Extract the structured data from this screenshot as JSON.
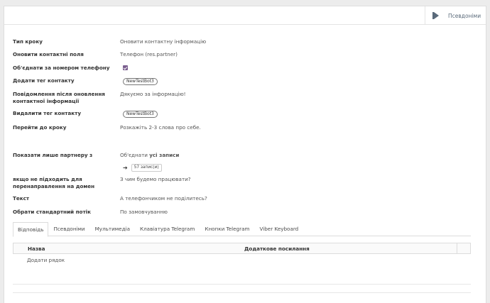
{
  "header": {
    "smart_button_label": "Псевдоніми",
    "smart_button_icon": "flag-icon"
  },
  "fields": {
    "step_type": {
      "label": "Тип кроку",
      "value": "Оновити контактну інформацію"
    },
    "update_fields": {
      "label": "Оновити контактні поля",
      "value": "Телефон (res.partner)"
    },
    "merge_by_phone": {
      "label": "Об'єднати за номером телефону",
      "checked": true
    },
    "add_tag": {
      "label": "Додати тег контакту",
      "tag": "NewTestBot3"
    },
    "message_after_update": {
      "label": "Повідомлення після оновлення контактної інформації",
      "value": "Дякуємо за інформацію!"
    },
    "remove_tag": {
      "label": "Видалити тег контакту",
      "tag": "NewTestBot3"
    },
    "go_to_step": {
      "label": "Перейти до кроку",
      "value": "Розкажіть 2-3 слова про себе."
    },
    "show_only_partner": {
      "label": "Показати лише партнеру з",
      "value_prefix": "Об'єднати ",
      "value_bold": "усі записи",
      "records_button": "57 запис(и)"
    },
    "if_not_fit": {
      "label": "якщо не підходить для перенаправлення на домен",
      "value": "З чим будемо працювати?"
    },
    "text": {
      "label": "Текст",
      "value": "А телефончиком не поділитесь?"
    },
    "default_flow": {
      "label": "Обрати стандартний потік",
      "value": "По замовчуванню"
    }
  },
  "tabs": [
    {
      "label": "Відповідь",
      "active": true
    },
    {
      "label": "Псевдоніми",
      "active": false
    },
    {
      "label": "Мультимедіа",
      "active": false
    },
    {
      "label": "Клавіатура Telegram",
      "active": false
    },
    {
      "label": "Кнопки Telegram",
      "active": false
    },
    {
      "label": "Viber Keyboard",
      "active": false
    }
  ],
  "table": {
    "columns": [
      "Назва",
      "Додаткове посилання"
    ],
    "add_row_label": "Додати рядок"
  },
  "colors": {
    "checkbox": "#7b5f8f",
    "background": "#ececec"
  }
}
